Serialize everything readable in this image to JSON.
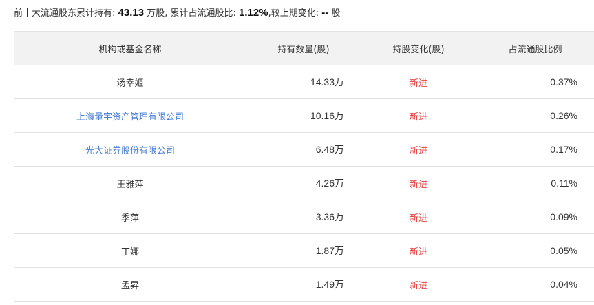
{
  "summary": {
    "prefix": "前十大流通股东累计持有:",
    "total": "43.13",
    "total_unit": "万股,",
    "ratio_label": "累计占流通股比:",
    "ratio": "1.12%",
    "change_label": ",较上期变化:",
    "change": "--",
    "change_unit": "股"
  },
  "table": {
    "columns": [
      "机构或基金名称",
      "持有数量(股)",
      "持股变化(股)",
      "占流通股比例"
    ],
    "rows": [
      {
        "name": "汤幸姬",
        "is_link": false,
        "qty": "14.33万",
        "change": "新进",
        "ratio": "0.37%"
      },
      {
        "name": "上海量宇资产管理有限公司",
        "is_link": true,
        "qty": "10.16万",
        "change": "新进",
        "ratio": "0.26%"
      },
      {
        "name": "光大证券股份有限公司",
        "is_link": true,
        "qty": "6.48万",
        "change": "新进",
        "ratio": "0.17%"
      },
      {
        "name": "王雅萍",
        "is_link": false,
        "qty": "4.26万",
        "change": "新进",
        "ratio": "0.11%"
      },
      {
        "name": "季萍",
        "is_link": false,
        "qty": "3.36万",
        "change": "新进",
        "ratio": "0.09%"
      },
      {
        "name": "丁娜",
        "is_link": false,
        "qty": "1.87万",
        "change": "新进",
        "ratio": "0.05%"
      },
      {
        "name": "孟昇",
        "is_link": false,
        "qty": "1.49万",
        "change": "新进",
        "ratio": "0.04%"
      }
    ]
  },
  "colors": {
    "link": "#4a7fd4",
    "change": "#e53d3d",
    "header_bg": "#f2f2f2",
    "border": "#e3e3e3"
  }
}
